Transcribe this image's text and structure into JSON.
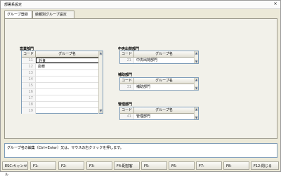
{
  "window": {
    "title": "部署系設定",
    "close_label": "×"
  },
  "tabs": [
    {
      "label": "グループ登録"
    },
    {
      "label": "絵報別グループ設定"
    }
  ],
  "sales": {
    "label": "営業部門",
    "headers": {
      "code": "コード",
      "name": "グループ名"
    },
    "rows": [
      {
        "code": "11",
        "name": "外食"
      },
      {
        "code": "12",
        "name": "店様"
      },
      {
        "code": "13",
        "name": ""
      },
      {
        "code": "14",
        "name": ""
      },
      {
        "code": "15",
        "name": ""
      },
      {
        "code": "16",
        "name": ""
      },
      {
        "code": "17",
        "name": ""
      },
      {
        "code": "18",
        "name": ""
      },
      {
        "code": "19",
        "name": ""
      }
    ]
  },
  "central": {
    "label": "中央出荷部門",
    "headers": {
      "code": "コード",
      "name": "グループ名"
    },
    "rows": [
      {
        "code": "21",
        "name": "中央出荷部門"
      }
    ]
  },
  "support": {
    "label": "補助部門",
    "headers": {
      "code": "コード",
      "name": "グループ名"
    },
    "rows": [
      {
        "code": "31",
        "name": "補助部門"
      }
    ]
  },
  "admin": {
    "label": "管理部門",
    "headers": {
      "code": "コード",
      "name": "グループ名"
    },
    "rows": [
      {
        "code": "41",
        "name": "管理部門"
      }
    ]
  },
  "help": {
    "text": "グループ名の編集（Ctrl+Enter）又は、マウスの右クリックを押します。"
  },
  "fkeys": [
    {
      "label": "ESC:キャンセル"
    },
    {
      "label": "F1:"
    },
    {
      "label": "F2:"
    },
    {
      "label": "F3:"
    },
    {
      "label": "F4:配替客"
    },
    {
      "label": "F5:"
    },
    {
      "label": "F6:"
    },
    {
      "label": "F7:"
    },
    {
      "label": "F8:"
    },
    {
      "label": "F12:閉じる"
    }
  ]
}
